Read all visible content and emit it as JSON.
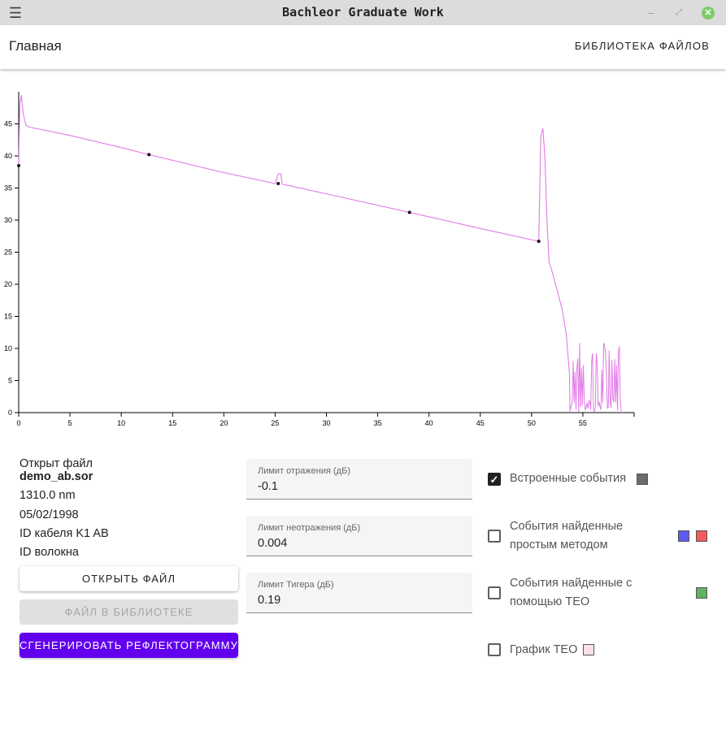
{
  "window": {
    "title": "Bachleor Graduate Work",
    "menu_icon": "hamburger-icon",
    "minimize_icon": "minimize-icon",
    "restore_icon": "restore-icon",
    "close_icon": "close-icon"
  },
  "appbar": {
    "home_label": "Главная",
    "library_label": "БИБЛИОТЕКА ФАЙЛОВ"
  },
  "chart_data": {
    "type": "line",
    "xlim": [
      0,
      60
    ],
    "ylim": [
      0,
      50
    ],
    "xticks": [
      0,
      5,
      10,
      15,
      20,
      25,
      30,
      35,
      40,
      45,
      50,
      55
    ],
    "yticks": [
      0,
      5,
      10,
      15,
      20,
      25,
      30,
      35,
      40,
      45
    ],
    "grid": false,
    "series": [
      {
        "color": "#e27ae6",
        "x": [
          0,
          0.1,
          0.25,
          0.45,
          0.7,
          1,
          5,
          10,
          12.7,
          20,
          25,
          25.3,
          25.55,
          25.7,
          26,
          30,
          38.1,
          45,
          50.7,
          50.9,
          51.1,
          51.3,
          51.5,
          51.7,
          52,
          52.5,
          53,
          53.4,
          53.7,
          53.75
        ],
        "y": [
          38.5,
          48,
          49.5,
          46.5,
          44.8,
          44.5,
          43.2,
          41.3,
          40.2,
          37.4,
          35.7,
          37.2,
          37.2,
          35.6,
          35.5,
          34.1,
          31.2,
          28.7,
          26.7,
          43,
          44.3,
          40,
          30,
          23.5,
          22,
          19,
          16,
          12,
          6,
          0
        ]
      },
      {
        "color": "#e27ae6",
        "kind": "noise",
        "x_range": [
          53.7,
          60
        ],
        "y_range": [
          0,
          11
        ]
      }
    ],
    "events": [
      {
        "x": 0,
        "y": 38.5
      },
      {
        "x": 12.7,
        "y": 40.2
      },
      {
        "x": 25.3,
        "y": 35.7
      },
      {
        "x": 38.1,
        "y": 31.2
      },
      {
        "x": 50.7,
        "y": 26.7
      }
    ]
  },
  "file_info": {
    "opened_label": "Открыт файл",
    "filename": "demo_ab.sor",
    "wavelength": "1310.0 nm",
    "date": "05/02/1998",
    "cable_id": "ID кабеля K1 AB",
    "fiber_id": "ID волокна"
  },
  "buttons": {
    "open_file": "ОТКРЫТЬ ФАЙЛ",
    "file_in_library": "ФАЙЛ В БИБЛИОТЕКЕ",
    "generate": "СГЕНЕРИРОВАТЬ РЕФЛЕКТОГРАММУ"
  },
  "fields": {
    "reflection_limit": {
      "label": "Лимит отражения (дБ)",
      "value": "-0.1"
    },
    "nonreflection_limit": {
      "label": "Лимит неотражения (дБ)",
      "value": "0.004"
    },
    "teager_limit": {
      "label": "Лимит Тигера (дБ)",
      "value": "0.19"
    }
  },
  "options": [
    {
      "label_lines": [
        "Встроенные события"
      ],
      "checked": true,
      "colors": [
        "#6b6b6b"
      ]
    },
    {
      "label_lines": [
        "События найденные",
        "простым методом"
      ],
      "checked": false,
      "colors": [
        "#5c5cf2",
        "#f25c5c"
      ]
    },
    {
      "label_lines": [
        "События найденные с",
        "помощью TEO"
      ],
      "checked": false,
      "colors": [
        "#62b062"
      ]
    },
    {
      "label_lines": [
        "График TEO"
      ],
      "checked": false,
      "colors": [
        "#fce0e6"
      ]
    }
  ]
}
